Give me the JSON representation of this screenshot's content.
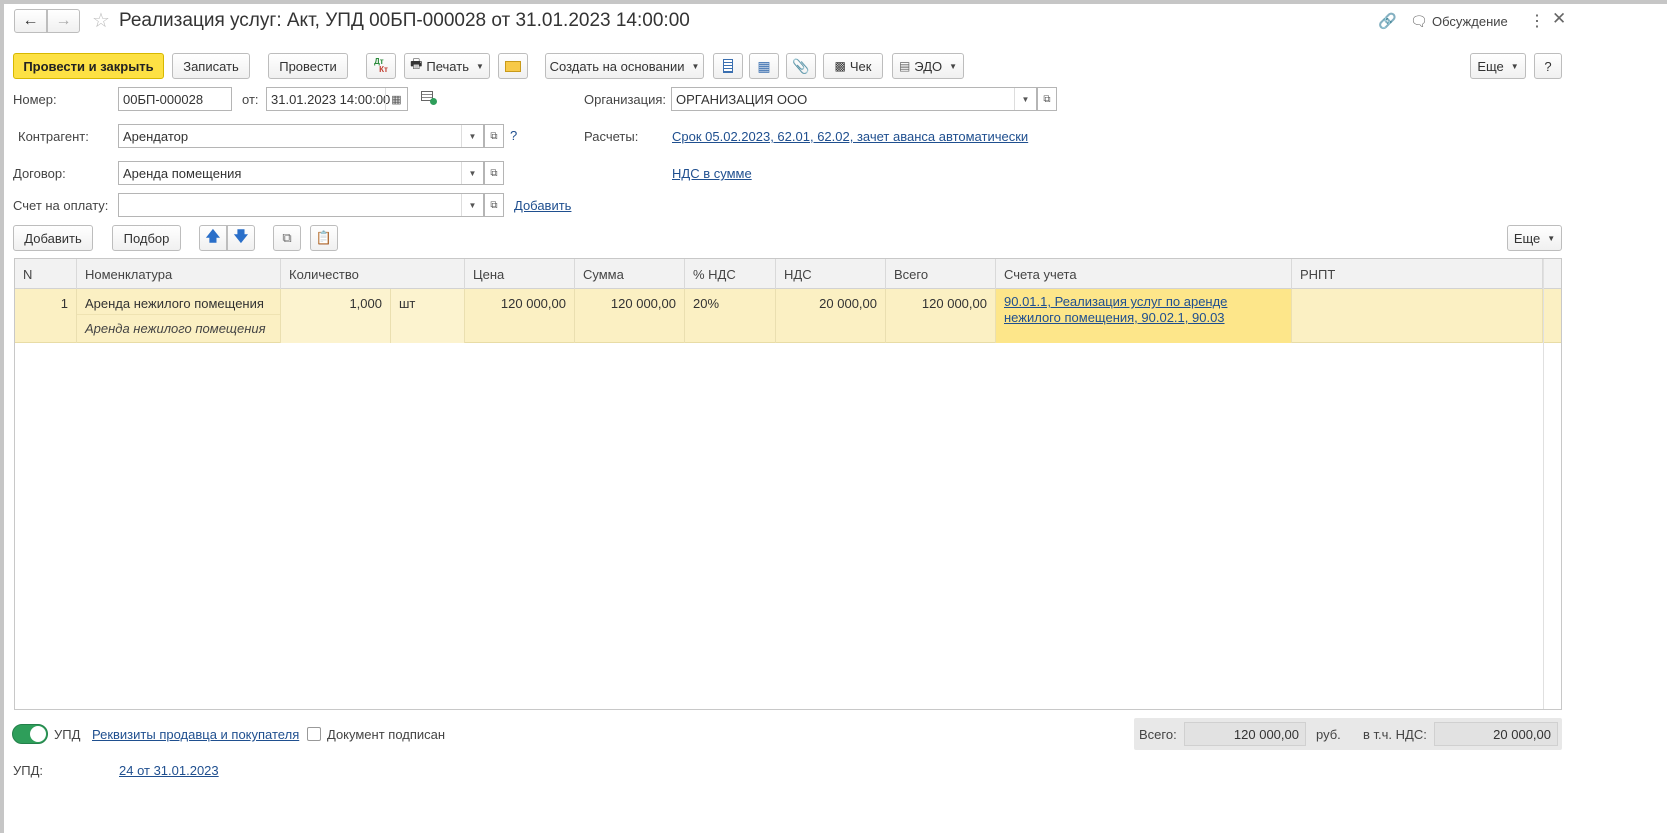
{
  "window": {
    "title": "Реализация услуг: Акт, УПД 00БП-000028 от 31.01.2023 14:00:00",
    "discussion_label": "Обсуждение"
  },
  "toolbar": {
    "post_close": "Провести и закрыть",
    "save": "Записать",
    "post": "Провести",
    "dtkt_top": "Дт",
    "dtkt_bottom": "Кт",
    "print": "Печать",
    "create_based": "Создать на основании",
    "check": "Чек",
    "edo": "ЭДО",
    "more": "Еще",
    "help": "?"
  },
  "form": {
    "number_label": "Номер:",
    "number_value": "00БП-000028",
    "date_label": "от:",
    "date_value": "31.01.2023 14:00:00",
    "org_label": "Организация:",
    "org_value": "ОРГАНИЗАЦИЯ ООО",
    "counterparty_label": "Контрагент:",
    "counterparty_value": "Арендатор",
    "counterparty_help": "?",
    "settlements_label": "Расчеты:",
    "settlements_link": "Срок 05.02.2023, 62.01, 62.02, зачет аванса автоматически",
    "contract_label": "Договор:",
    "contract_value": "Аренда помещения",
    "vat_link": "НДС в сумме",
    "invoice_label": "Счет на оплату:",
    "invoice_value": "",
    "invoice_add": "Добавить"
  },
  "table_toolbar": {
    "add": "Добавить",
    "pick": "Подбор",
    "more": "Еще"
  },
  "table": {
    "columns": [
      "N",
      "Номенклатура",
      "Количество",
      "Цена",
      "Сумма",
      "% НДС",
      "НДС",
      "Всего",
      "Счета учета",
      "РНПТ"
    ],
    "rows": [
      {
        "n": "1",
        "item": "Аренда нежилого помещения",
        "item_desc": "Аренда нежилого помещения",
        "qty": "1,000",
        "unit": "шт",
        "price": "120 000,00",
        "sum": "120 000,00",
        "vat_rate": "20%",
        "vat": "20 000,00",
        "total": "120 000,00",
        "accounts": "90.01.1, Реализация услуг по аренде нежилого помещения, 90.02.1, 90.03",
        "rnpt": ""
      }
    ]
  },
  "footer": {
    "upd_toggle": "УПД",
    "requisites_link": "Реквизиты продавца и покупателя",
    "signed_label": "Документ подписан",
    "total_label": "Всего:",
    "total_value": "120 000,00",
    "currency": "руб.",
    "vat_label": "в т.ч. НДС:",
    "vat_value": "20 000,00",
    "upd_label": "УПД:",
    "upd_link": "24 от 31.01.2023"
  },
  "colors": {
    "primary_button": "#fde144",
    "selected_row": "#fbf0c3",
    "selected_cell": "#fde68a",
    "link": "#1f4f8f",
    "toggle_on": "#2e9e5a"
  }
}
